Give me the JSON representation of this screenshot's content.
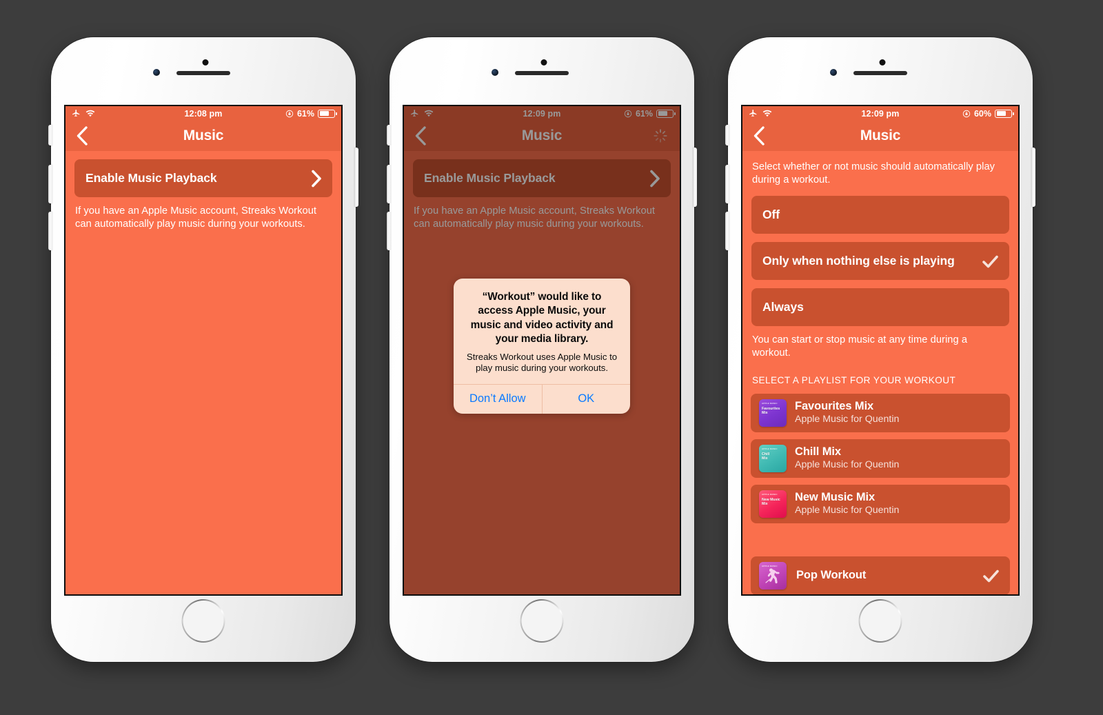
{
  "phones": [
    {
      "id": "phone-1",
      "statusbar": {
        "time": "12:08 pm",
        "battery_percent": "61%",
        "icons": [
          "airplane-mode-icon",
          "wifi-icon",
          "rotation-lock-icon",
          "battery-icon"
        ]
      },
      "navbar": {
        "title": "Music",
        "back_icon": "chevron-left-icon",
        "spinner": false
      },
      "content": {
        "enable_row_label": "Enable Music Playback",
        "footnote": "If you have an Apple Music account, Streaks Workout can automatically play music during your workouts."
      },
      "alert": null
    },
    {
      "id": "phone-2",
      "statusbar": {
        "time": "12:09 pm",
        "battery_percent": "61%",
        "icons": [
          "airplane-mode-icon",
          "wifi-icon",
          "rotation-lock-icon",
          "battery-icon"
        ]
      },
      "navbar": {
        "title": "Music",
        "back_icon": "chevron-left-icon",
        "spinner": true
      },
      "content": {
        "enable_row_label": "Enable Music Playback",
        "footnote": "If you have an Apple Music account, Streaks Workout can automatically play music during your workouts."
      },
      "alert": {
        "title": "“Workout” would like to access Apple Music, your music and video activity and your media library.",
        "message": "Streaks Workout uses Apple Music to play music during your workouts.",
        "buttons": [
          "Don’t Allow",
          "OK"
        ]
      }
    },
    {
      "id": "phone-3",
      "statusbar": {
        "time": "12:09 pm",
        "battery_percent": "60%",
        "icons": [
          "airplane-mode-icon",
          "wifi-icon",
          "rotation-lock-icon",
          "battery-icon"
        ]
      },
      "navbar": {
        "title": "Music",
        "back_icon": "chevron-left-icon",
        "spinner": false
      },
      "content": {
        "blurb": "Select whether or not music should automatically play during a workout.",
        "options": [
          {
            "label": "Off",
            "selected": false
          },
          {
            "label": "Only when nothing else is playing",
            "selected": true
          },
          {
            "label": "Always",
            "selected": false
          }
        ],
        "options_footnote": "You can start or stop music at any time during a workout.",
        "section_header": "SELECT A PLAYLIST FOR YOUR WORKOUT",
        "playlists": [
          {
            "title": "Favourites Mix",
            "subtitle": "Apple Music for Quentin",
            "art_caption": "APPLE MUSIC",
            "art_label": "Favourites\nMix",
            "selected": false
          },
          {
            "title": "Chill Mix",
            "subtitle": "Apple Music for Quentin",
            "art_caption": "APPLE MUSIC",
            "art_label": "Chill\nMix",
            "selected": false
          },
          {
            "title": "New Music Mix",
            "subtitle": "Apple Music for Quentin",
            "art_caption": "APPLE MUSIC",
            "art_label": "New Music\nMix",
            "selected": false
          },
          {
            "title": "Pop Workout",
            "subtitle": "",
            "art_caption": "APPLE MUSIC",
            "art_label": "",
            "selected": true
          }
        ]
      },
      "alert": null
    }
  ],
  "colors": {
    "page_background": "#3d3d3d",
    "screen_background": "#FA6F4C",
    "bar_background": "#E8623F",
    "card_background": "#C9512F",
    "alert_background": "#FCDECD",
    "alert_button_text": "#0A7AFF",
    "text_primary": "#FFFFFF"
  }
}
